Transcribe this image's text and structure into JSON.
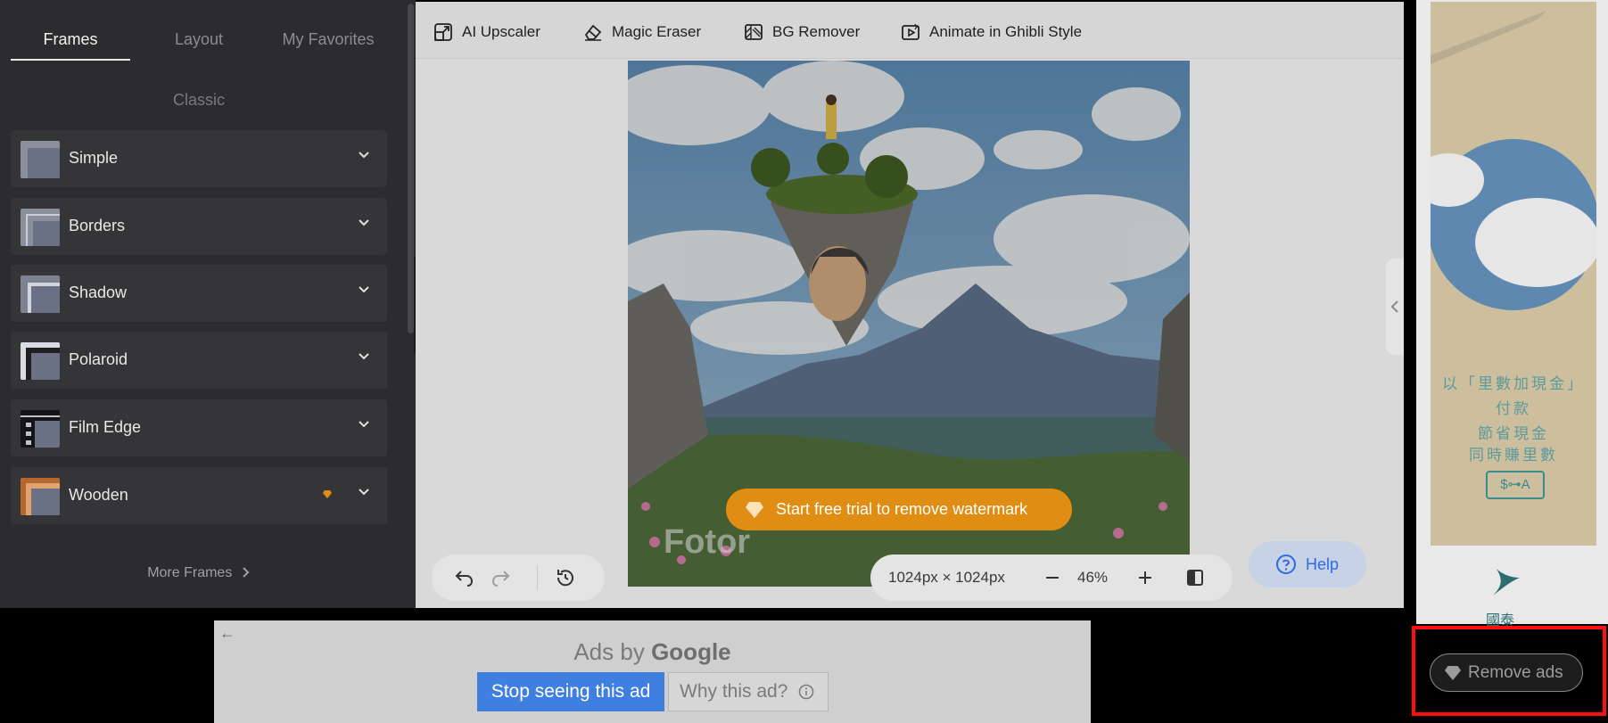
{
  "sidebar": {
    "tabs": [
      {
        "label": "Frames",
        "active": true
      },
      {
        "label": "Layout",
        "active": false
      },
      {
        "label": "My Favorites",
        "active": false
      }
    ],
    "section_title": "Classic",
    "items": [
      {
        "label": "Simple",
        "thumb_icon": "frame-simple-icon",
        "premium": false
      },
      {
        "label": "Borders",
        "thumb_icon": "frame-borders-icon",
        "premium": false
      },
      {
        "label": "Shadow",
        "thumb_icon": "frame-shadow-icon",
        "premium": false
      },
      {
        "label": "Polaroid",
        "thumb_icon": "frame-polaroid-icon",
        "premium": false
      },
      {
        "label": "Film Edge",
        "thumb_icon": "frame-film-edge-icon",
        "premium": false
      },
      {
        "label": "Wooden",
        "thumb_icon": "frame-wooden-icon",
        "premium": true
      }
    ],
    "more_frames": "More Frames"
  },
  "toolbar": {
    "tools": [
      {
        "label": "AI Upscaler",
        "icon": "upscale-icon"
      },
      {
        "label": "Magic Eraser",
        "icon": "eraser-icon"
      },
      {
        "label": "BG Remover",
        "icon": "bg-remover-icon"
      },
      {
        "label": "Animate in Ghibli Style",
        "icon": "animate-icon"
      }
    ]
  },
  "canvas": {
    "watermark_text": "Fotor",
    "trial_button": "Start free trial to remove watermark"
  },
  "zoom": {
    "dimensions": "1024px × 1024px",
    "percent": "46%"
  },
  "help": {
    "label": "Help"
  },
  "right_ad": {
    "lines": [
      "以「里數加現金」",
      "付款",
      "節省現金",
      "同時賺里數"
    ],
    "badge": "$⊶A",
    "logo_text": "國泰"
  },
  "remove_ads": {
    "label": "Remove ads"
  },
  "bottom_ad": {
    "ads_by": "Ads by",
    "google": "Google",
    "stop_label": "Stop seeing this ad",
    "why_label": "Why this ad?"
  },
  "colors": {
    "sidebar_bg": "#2c2c2e",
    "accent_orange": "#e08d14",
    "help_blue": "#2e6be6",
    "highlight_red": "#ff1010"
  }
}
